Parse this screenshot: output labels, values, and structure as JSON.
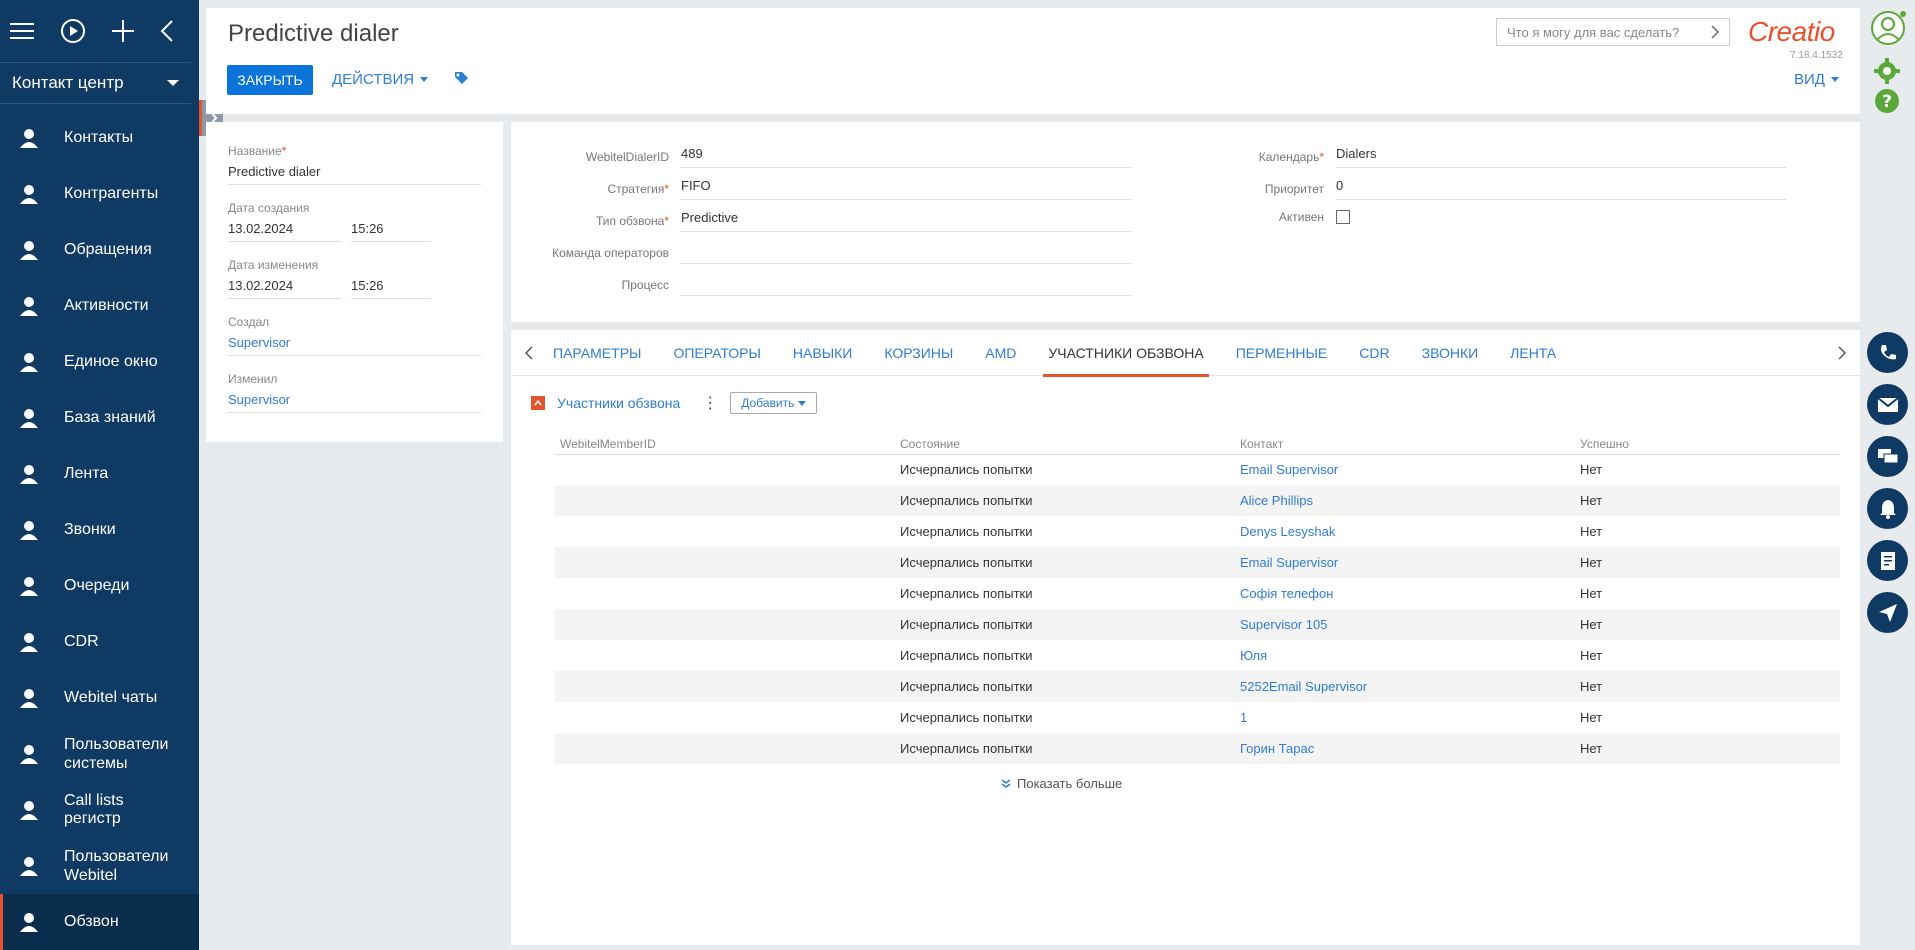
{
  "sidebar": {
    "workplace": "Контакт центр",
    "items": [
      {
        "label": "Контакты",
        "icon": "contacts-icon"
      },
      {
        "label": "Контрагенты",
        "icon": "accounts-icon"
      },
      {
        "label": "Обращения",
        "icon": "cases-icon"
      },
      {
        "label": "Активности",
        "icon": "activities-icon"
      },
      {
        "label": "Единое окно",
        "icon": "single-window-icon"
      },
      {
        "label": "База знаний",
        "icon": "knowledge-base-icon"
      },
      {
        "label": "Лента",
        "icon": "feed-icon"
      },
      {
        "label": "Звонки",
        "icon": "calls-icon"
      },
      {
        "label": "Очереди",
        "icon": "queues-icon"
      },
      {
        "label": "CDR",
        "icon": "cdr-icon"
      },
      {
        "label": "Webitel чаты",
        "icon": "chats-icon"
      },
      {
        "label": "Пользователи системы",
        "icon": "system-users-icon"
      },
      {
        "label": "Call lists регистр",
        "icon": "call-lists-icon"
      },
      {
        "label": "Пользователи Webitel",
        "icon": "webitel-users-icon"
      },
      {
        "label": "Обзвон",
        "icon": "dialer-icon"
      }
    ]
  },
  "header": {
    "title": "Predictive dialer",
    "close_label": "ЗАКРЫТЬ",
    "actions_label": "ДЕЙСТВИЯ",
    "view_label": "ВИД",
    "search_placeholder": "Что я могу для вас сделать?",
    "logo": "Creatio",
    "version": "7.18.4.1532"
  },
  "left_panel": {
    "name_label": "Название",
    "name_value": "Predictive dialer",
    "created_label": "Дата создания",
    "created_date": "13.02.2024",
    "created_time": "15:26",
    "modified_label": "Дата изменения",
    "modified_date": "13.02.2024",
    "modified_time": "15:26",
    "created_by_label": "Создал",
    "created_by": "Supervisor",
    "modified_by_label": "Изменил",
    "modified_by": "Supervisor"
  },
  "form": {
    "dialer_id_label": "WebitelDialerID",
    "dialer_id": "489",
    "strategy_label": "Стратегия",
    "strategy": "FIFO",
    "type_label": "Тип обзвона",
    "type": "Predictive",
    "team_label": "Команда операторов",
    "team": "",
    "process_label": "Процесс",
    "process": "",
    "calendar_label": "Календарь",
    "calendar": "Dialers",
    "priority_label": "Приоритет",
    "priority": "0",
    "active_label": "Активен",
    "active": false
  },
  "tabs": [
    "ПАРАМЕТРЫ",
    "ОПЕРАТОРЫ",
    "НАВЫКИ",
    "КОРЗИНЫ",
    "AMD",
    "УЧАСТНИКИ ОБЗВОНА",
    "ПЕРМЕННЫЕ",
    "CDR",
    "ЗВОНКИ",
    "ЛЕНТА"
  ],
  "active_tab": "УЧАСТНИКИ ОБЗВОНА",
  "detail": {
    "title": "Участники обзвона",
    "add_label": "Добавить",
    "columns": [
      "WebitelMemberID",
      "Состояние",
      "Контакт",
      "Успешно"
    ],
    "rows": [
      [
        "",
        "Исчерпались попытки",
        "Email Supervisor",
        "Нет"
      ],
      [
        "",
        "Исчерпались попытки",
        "Alice Phillips",
        "Нет"
      ],
      [
        "",
        "Исчерпались попытки",
        "Denys Lesyshak",
        "Нет"
      ],
      [
        "",
        "Исчерпались попытки",
        "Email Supervisor",
        "Нет"
      ],
      [
        "",
        "Исчерпались попытки",
        "Софія телефон",
        "Нет"
      ],
      [
        "",
        "Исчерпались попытки",
        "Supervisor 105",
        "Нет"
      ],
      [
        "",
        "Исчерпались попытки",
        "Юля",
        "Нет"
      ],
      [
        "",
        "Исчерпались попытки",
        "5252Email Supervisor",
        "Нет"
      ],
      [
        "",
        "Исчерпались попытки",
        "1",
        "Нет"
      ],
      [
        "",
        "Исчерпались попытки",
        "Горин Тарас",
        "Нет"
      ]
    ],
    "show_more": "Показать больше"
  },
  "colors": {
    "accent": "#e5532d",
    "primary": "#0a74db",
    "sidebar": "#0f3a63",
    "link": "#2f7cd3"
  }
}
